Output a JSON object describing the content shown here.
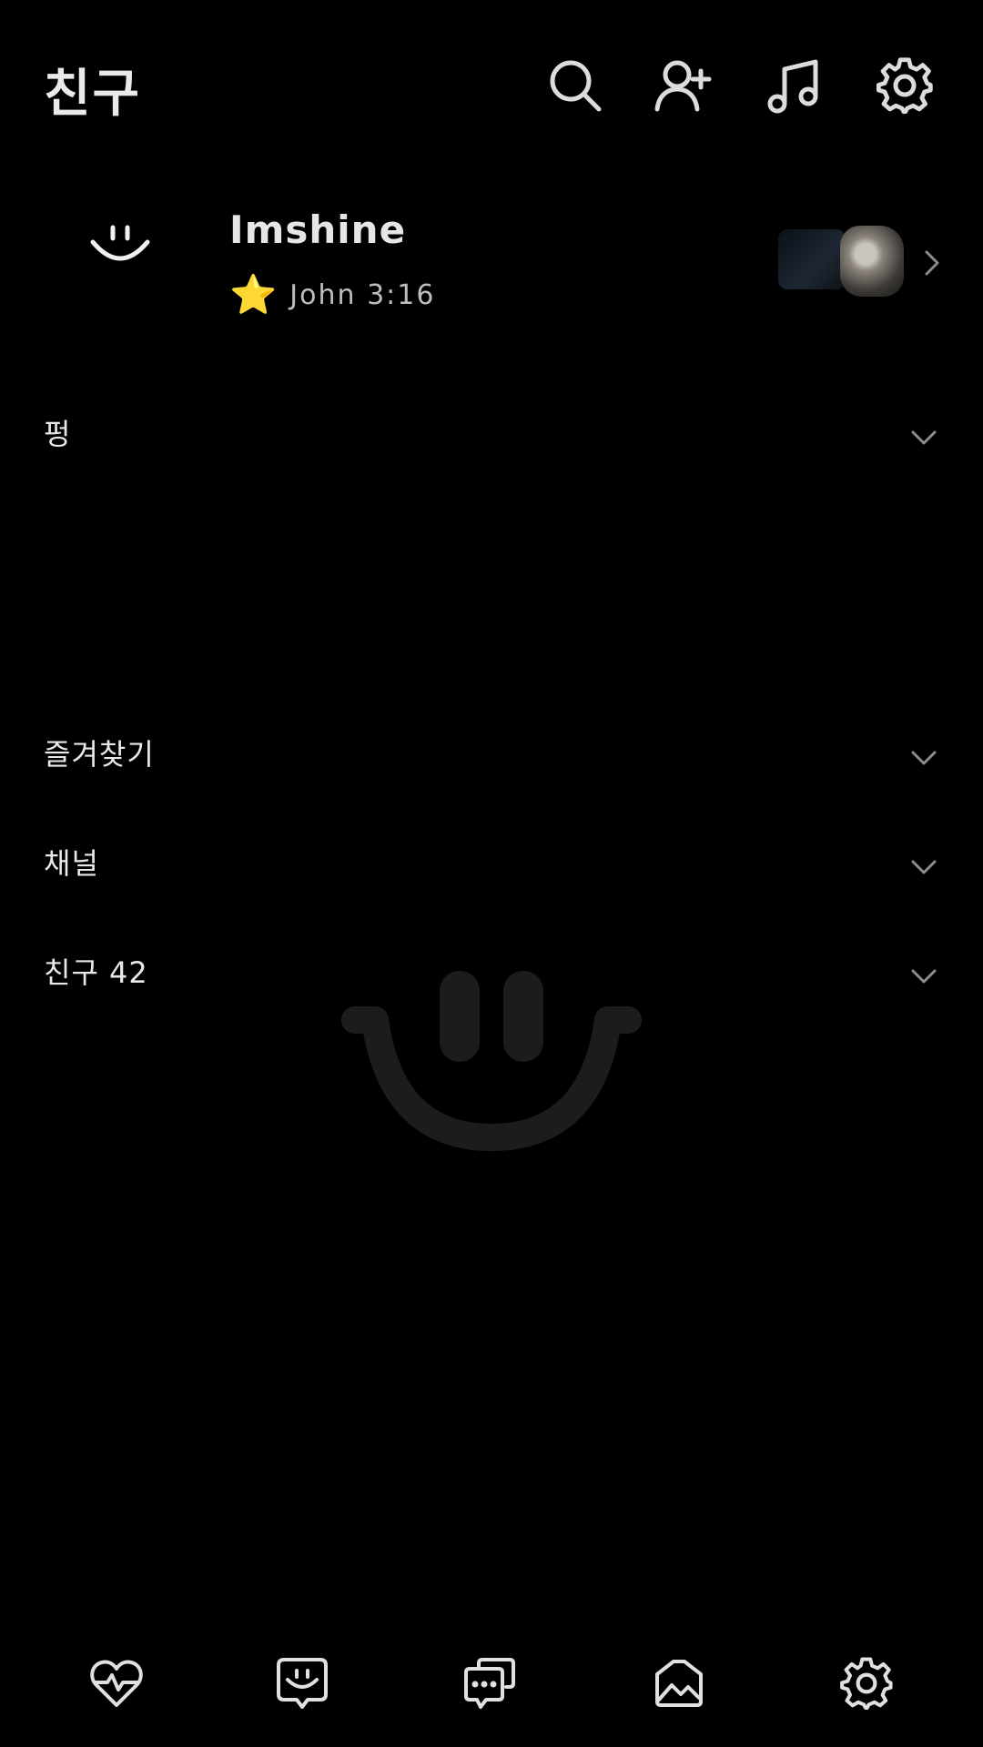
{
  "header": {
    "title": "친구",
    "icons": [
      "search-icon",
      "add-friend-icon",
      "music-icon",
      "settings-icon"
    ]
  },
  "profile": {
    "name": "Imshine",
    "status_emoji": "⭐",
    "status_text": "John 3:16",
    "avatar": "smile-face-icon"
  },
  "sections": [
    {
      "label": "펑"
    },
    {
      "label": "즐겨찾기"
    },
    {
      "label": "채널"
    },
    {
      "label": "친구 42"
    }
  ],
  "bottom_nav": [
    "heart-icon",
    "chat-face-icon",
    "chats-icon",
    "gallery-icon",
    "settings-icon"
  ],
  "colors": {
    "background": "#000000",
    "text": "#e8e8e8",
    "muted": "#8c8c8c",
    "star": "#ffc23a",
    "watermark": "#1a1a1a"
  }
}
